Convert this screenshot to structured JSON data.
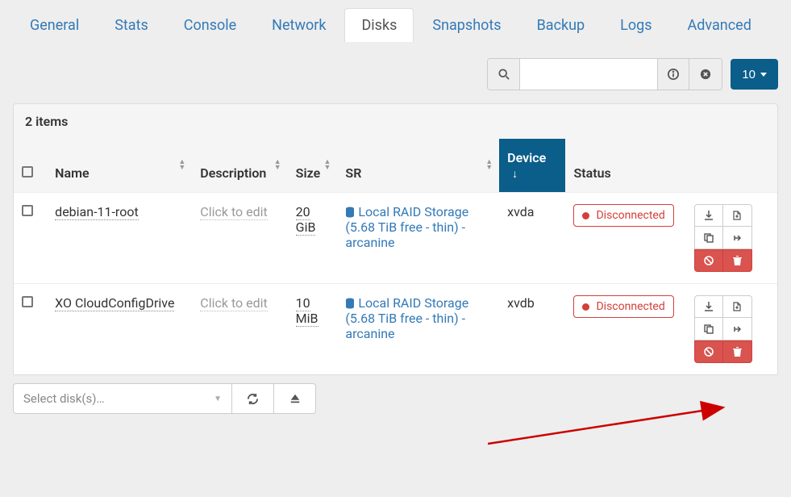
{
  "tabs": [
    "General",
    "Stats",
    "Console",
    "Network",
    "Disks",
    "Snapshots",
    "Backup",
    "Logs",
    "Advanced"
  ],
  "active_tab": "Disks",
  "page_size": "10",
  "items_count": "2 items",
  "columns": {
    "name": "Name",
    "description": "Description",
    "size": "Size",
    "sr": "SR",
    "device": "Device",
    "status": "Status"
  },
  "click_to_edit": "Click to edit",
  "rows": [
    {
      "name": "debian-11-root",
      "size": "20 GiB",
      "sr": "Local RAID Storage (5.68 TiB free - thin) - arcanine",
      "device": "xvda",
      "status": "Disconnected"
    },
    {
      "name": "XO CloudConfigDrive",
      "size": "10 MiB",
      "sr": "Local RAID Storage (5.68 TiB free - thin) - arcanine",
      "device": "xvdb",
      "status": "Disconnected"
    }
  ],
  "footer": {
    "select_placeholder": "Select disk(s)…"
  }
}
